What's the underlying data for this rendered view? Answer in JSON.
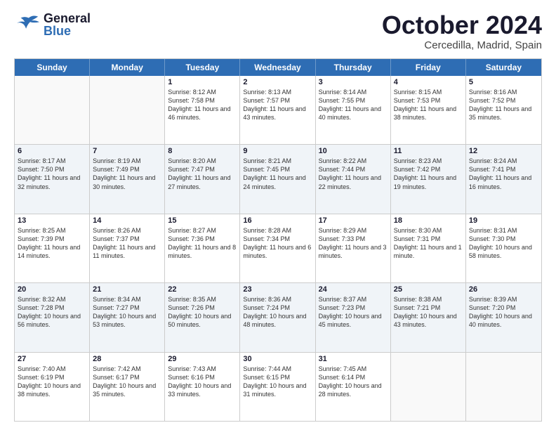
{
  "header": {
    "logo": {
      "part1": "General",
      "part2": "Blue"
    },
    "title": "October 2024",
    "subtitle": "Cercedilla, Madrid, Spain"
  },
  "day_names": [
    "Sunday",
    "Monday",
    "Tuesday",
    "Wednesday",
    "Thursday",
    "Friday",
    "Saturday"
  ],
  "weeks": [
    [
      {
        "day": "",
        "info": ""
      },
      {
        "day": "",
        "info": ""
      },
      {
        "day": "1",
        "info": "Sunrise: 8:12 AM\nSunset: 7:58 PM\nDaylight: 11 hours and 46 minutes."
      },
      {
        "day": "2",
        "info": "Sunrise: 8:13 AM\nSunset: 7:57 PM\nDaylight: 11 hours and 43 minutes."
      },
      {
        "day": "3",
        "info": "Sunrise: 8:14 AM\nSunset: 7:55 PM\nDaylight: 11 hours and 40 minutes."
      },
      {
        "day": "4",
        "info": "Sunrise: 8:15 AM\nSunset: 7:53 PM\nDaylight: 11 hours and 38 minutes."
      },
      {
        "day": "5",
        "info": "Sunrise: 8:16 AM\nSunset: 7:52 PM\nDaylight: 11 hours and 35 minutes."
      }
    ],
    [
      {
        "day": "6",
        "info": "Sunrise: 8:17 AM\nSunset: 7:50 PM\nDaylight: 11 hours and 32 minutes."
      },
      {
        "day": "7",
        "info": "Sunrise: 8:19 AM\nSunset: 7:49 PM\nDaylight: 11 hours and 30 minutes."
      },
      {
        "day": "8",
        "info": "Sunrise: 8:20 AM\nSunset: 7:47 PM\nDaylight: 11 hours and 27 minutes."
      },
      {
        "day": "9",
        "info": "Sunrise: 8:21 AM\nSunset: 7:45 PM\nDaylight: 11 hours and 24 minutes."
      },
      {
        "day": "10",
        "info": "Sunrise: 8:22 AM\nSunset: 7:44 PM\nDaylight: 11 hours and 22 minutes."
      },
      {
        "day": "11",
        "info": "Sunrise: 8:23 AM\nSunset: 7:42 PM\nDaylight: 11 hours and 19 minutes."
      },
      {
        "day": "12",
        "info": "Sunrise: 8:24 AM\nSunset: 7:41 PM\nDaylight: 11 hours and 16 minutes."
      }
    ],
    [
      {
        "day": "13",
        "info": "Sunrise: 8:25 AM\nSunset: 7:39 PM\nDaylight: 11 hours and 14 minutes."
      },
      {
        "day": "14",
        "info": "Sunrise: 8:26 AM\nSunset: 7:37 PM\nDaylight: 11 hours and 11 minutes."
      },
      {
        "day": "15",
        "info": "Sunrise: 8:27 AM\nSunset: 7:36 PM\nDaylight: 11 hours and 8 minutes."
      },
      {
        "day": "16",
        "info": "Sunrise: 8:28 AM\nSunset: 7:34 PM\nDaylight: 11 hours and 6 minutes."
      },
      {
        "day": "17",
        "info": "Sunrise: 8:29 AM\nSunset: 7:33 PM\nDaylight: 11 hours and 3 minutes."
      },
      {
        "day": "18",
        "info": "Sunrise: 8:30 AM\nSunset: 7:31 PM\nDaylight: 11 hours and 1 minute."
      },
      {
        "day": "19",
        "info": "Sunrise: 8:31 AM\nSunset: 7:30 PM\nDaylight: 10 hours and 58 minutes."
      }
    ],
    [
      {
        "day": "20",
        "info": "Sunrise: 8:32 AM\nSunset: 7:28 PM\nDaylight: 10 hours and 56 minutes."
      },
      {
        "day": "21",
        "info": "Sunrise: 8:34 AM\nSunset: 7:27 PM\nDaylight: 10 hours and 53 minutes."
      },
      {
        "day": "22",
        "info": "Sunrise: 8:35 AM\nSunset: 7:26 PM\nDaylight: 10 hours and 50 minutes."
      },
      {
        "day": "23",
        "info": "Sunrise: 8:36 AM\nSunset: 7:24 PM\nDaylight: 10 hours and 48 minutes."
      },
      {
        "day": "24",
        "info": "Sunrise: 8:37 AM\nSunset: 7:23 PM\nDaylight: 10 hours and 45 minutes."
      },
      {
        "day": "25",
        "info": "Sunrise: 8:38 AM\nSunset: 7:21 PM\nDaylight: 10 hours and 43 minutes."
      },
      {
        "day": "26",
        "info": "Sunrise: 8:39 AM\nSunset: 7:20 PM\nDaylight: 10 hours and 40 minutes."
      }
    ],
    [
      {
        "day": "27",
        "info": "Sunrise: 7:40 AM\nSunset: 6:19 PM\nDaylight: 10 hours and 38 minutes."
      },
      {
        "day": "28",
        "info": "Sunrise: 7:42 AM\nSunset: 6:17 PM\nDaylight: 10 hours and 35 minutes."
      },
      {
        "day": "29",
        "info": "Sunrise: 7:43 AM\nSunset: 6:16 PM\nDaylight: 10 hours and 33 minutes."
      },
      {
        "day": "30",
        "info": "Sunrise: 7:44 AM\nSunset: 6:15 PM\nDaylight: 10 hours and 31 minutes."
      },
      {
        "day": "31",
        "info": "Sunrise: 7:45 AM\nSunset: 6:14 PM\nDaylight: 10 hours and 28 minutes."
      },
      {
        "day": "",
        "info": ""
      },
      {
        "day": "",
        "info": ""
      }
    ]
  ]
}
